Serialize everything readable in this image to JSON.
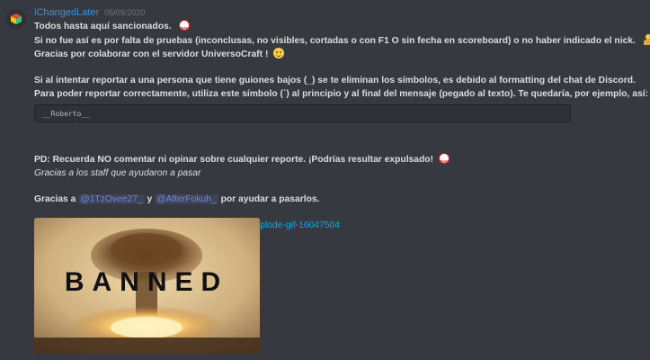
{
  "message": {
    "username": "iChangedLater",
    "timestamp": "05/09/2020",
    "line1": "Todos hasta aquí sancionados.",
    "line2": "Si no fue así es por falta de pruebas (inconclusas, no visibles, cortadas o con F1 O sin fecha en scoreboard) o no haber indicado el nick.",
    "line3": "Gracias por colaborar con el servidor UniversoCraft !",
    "line4": "Si al intentar reportar a una persona que tiene guiones bajos (_) se te eliminan los símbolos, es debido al formatting del chat de Discord.",
    "line5": "Para poder reportar correctamente, utiliza este símbolo (`) al principio y al final del mensaje (pegado al texto). Te quedaría, por ejemplo, así:",
    "code": "__Roberto__",
    "warning": "PD: Recuerda NO comentar ni opinar sobre cualquier reporte. ¡Podrías resultar expulsado!",
    "thanks_staff": "Gracias a los staff que ayudaron a pasar",
    "thanks_prefix": "Gracias a",
    "mention1": "@1TzOvee27_",
    "and": "y",
    "mention2": "@AfterFokuh_",
    "thanks_suffix": "por ayudar a pasarlos.",
    "link": "https://tenor.com/view/bane-no-banned-and-you-are-explode-gif-16047504",
    "gif_text": "BANNED"
  },
  "icons": {
    "avatar": "cube-icon",
    "ban_emoji": "ban-icon",
    "person_emoji": "person-shrug-icon",
    "smile_emoji": "sweat-smile-icon"
  },
  "colors": {
    "background": "#36393f",
    "username": "#3a8fe0",
    "link": "#00b0f4",
    "mention": "#7289da"
  }
}
